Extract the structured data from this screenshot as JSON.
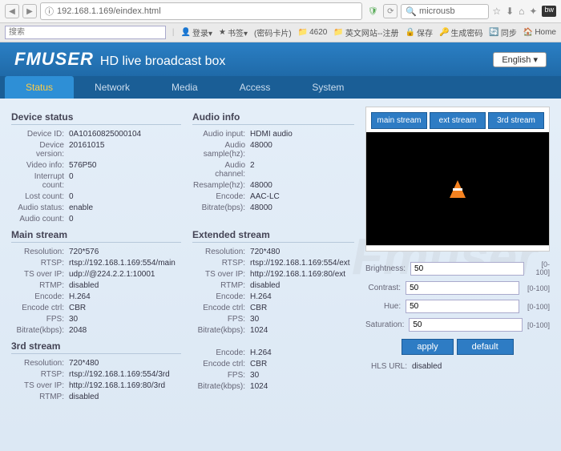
{
  "browser": {
    "url": "192.168.1.169/eindex.html",
    "search": "microusb"
  },
  "bookmarks": {
    "search_placeholder": "搜索",
    "items": [
      "登录▾",
      "书签▾",
      "(密码卡片)",
      "4620",
      "英文网站--注册",
      "保存",
      "生成密码",
      "同步",
      "Home"
    ]
  },
  "header": {
    "logo": "FMUSER",
    "subtitle": "HD live broadcast box",
    "lang": "English ▾"
  },
  "tabs": [
    "Status",
    "Network",
    "Media",
    "Access",
    "System"
  ],
  "watermark": "Fmuser",
  "device_status": {
    "title": "Device status",
    "rows": [
      {
        "label": "Device ID:",
        "value": "0A10160825000104"
      },
      {
        "label": "Device version:",
        "value": "20161015"
      },
      {
        "label": "Video info:",
        "value": "576P50"
      },
      {
        "label": "Interrupt count:",
        "value": "0"
      },
      {
        "label": "Lost count:",
        "value": "0"
      },
      {
        "label": "Audio status:",
        "value": "enable"
      },
      {
        "label": "Audio count:",
        "value": "0"
      }
    ]
  },
  "audio_info": {
    "title": "Audio info",
    "rows": [
      {
        "label": "Audio input:",
        "value": "HDMI audio"
      },
      {
        "label": "Audio sample(hz):",
        "value": "48000"
      },
      {
        "label": "Audio channel:",
        "value": "2"
      },
      {
        "label": "Resample(hz):",
        "value": "48000"
      },
      {
        "label": "Encode:",
        "value": "AAC-LC"
      },
      {
        "label": "Bitrate(bps):",
        "value": "48000"
      }
    ]
  },
  "main_stream": {
    "title": "Main stream",
    "rows": [
      {
        "label": "Resolution:",
        "value": "720*576"
      },
      {
        "label": "RTSP:",
        "value": "rtsp://192.168.1.169:554/main"
      },
      {
        "label": "TS over IP:",
        "value": "udp://@224.2.2.1:10001"
      },
      {
        "label": "RTMP:",
        "value": "disabled"
      },
      {
        "label": "Encode:",
        "value": "H.264"
      },
      {
        "label": "Encode ctrl:",
        "value": "CBR"
      },
      {
        "label": "FPS:",
        "value": "30"
      },
      {
        "label": "Bitrate(kbps):",
        "value": "2048"
      }
    ]
  },
  "ext_stream": {
    "title": "Extended stream",
    "rows": [
      {
        "label": "Resolution:",
        "value": "720*480"
      },
      {
        "label": "RTSP:",
        "value": "rtsp://192.168.1.169:554/ext"
      },
      {
        "label": "TS over IP:",
        "value": "http://192.168.1.169:80/ext"
      },
      {
        "label": "RTMP:",
        "value": "disabled"
      },
      {
        "label": "Encode:",
        "value": "H.264"
      },
      {
        "label": "Encode ctrl:",
        "value": "CBR"
      },
      {
        "label": "FPS:",
        "value": "30"
      },
      {
        "label": "Bitrate(kbps):",
        "value": "1024"
      }
    ]
  },
  "third_stream": {
    "title": "3rd stream",
    "rows": [
      {
        "label": "Resolution:",
        "value": "720*480"
      },
      {
        "label": "RTSP:",
        "value": "rtsp://192.168.1.169:554/3rd"
      },
      {
        "label": "TS over IP:",
        "value": "http://192.168.1.169:80/3rd"
      },
      {
        "label": "RTMP:",
        "value": "disabled"
      }
    ]
  },
  "third_stream_b": {
    "rows": [
      {
        "label": "Encode:",
        "value": "H.264"
      },
      {
        "label": "Encode ctrl:",
        "value": "CBR"
      },
      {
        "label": "FPS:",
        "value": "30"
      },
      {
        "label": "Bitrate(kbps):",
        "value": "1024"
      }
    ]
  },
  "preview": {
    "tabs": [
      "main stream",
      "ext stream",
      "3rd stream"
    ]
  },
  "controls": {
    "brightness": {
      "label": "Brightness:",
      "value": "50",
      "range": "[0-100]"
    },
    "contrast": {
      "label": "Contrast:",
      "value": "50",
      "range": "[0-100]"
    },
    "hue": {
      "label": "Hue:",
      "value": "50",
      "range": "[0-100]"
    },
    "saturation": {
      "label": "Saturation:",
      "value": "50",
      "range": "[0-100]"
    },
    "apply": "apply",
    "default": "default",
    "hls": {
      "label": "HLS URL:",
      "value": "disabled"
    }
  }
}
